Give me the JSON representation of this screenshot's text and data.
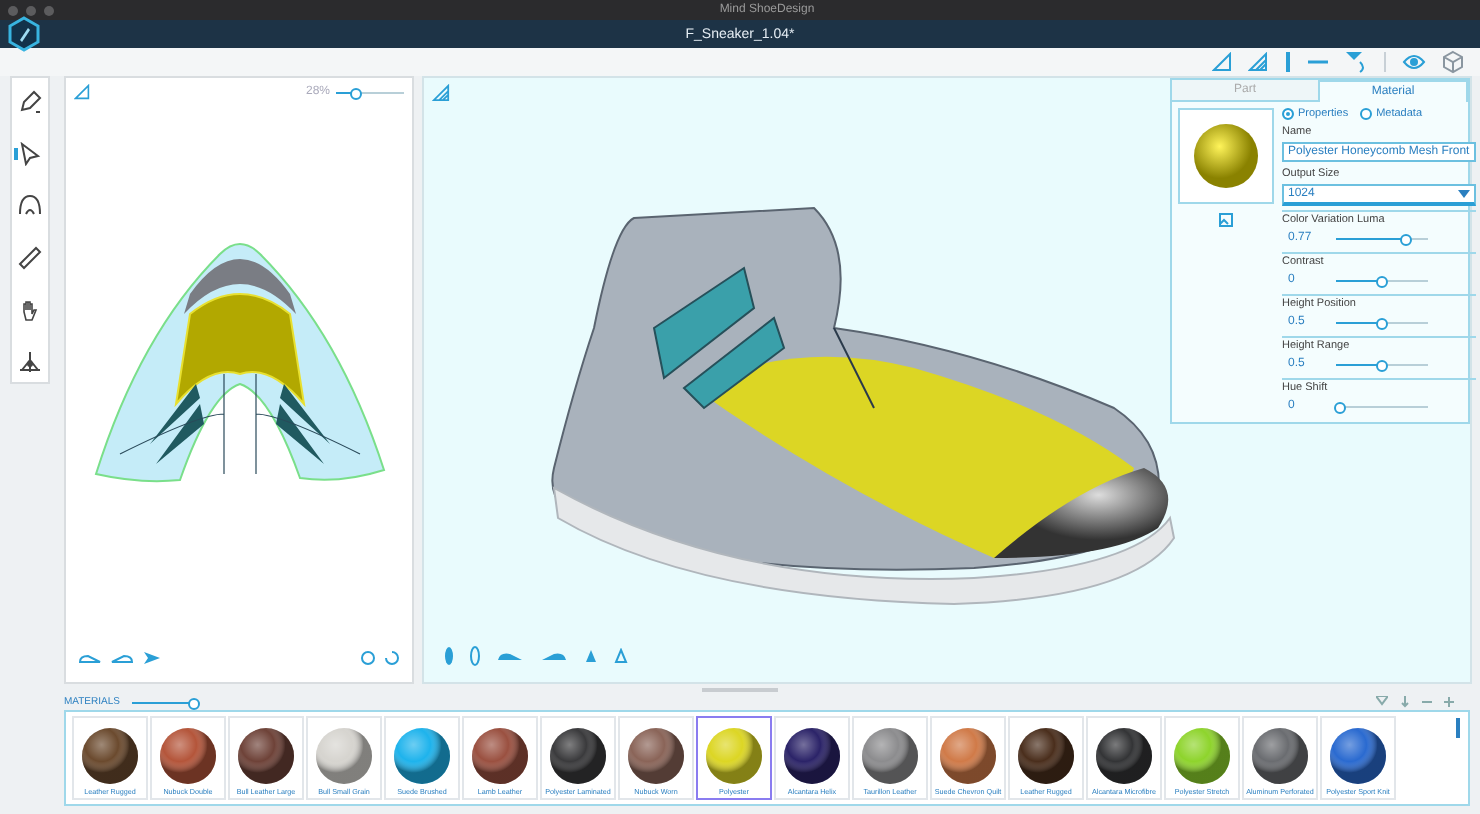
{
  "window": {
    "title": "Mind ShoeDesign",
    "document_title": "F_Sneaker_1.04*"
  },
  "pattern_panel": {
    "zoom": "28%",
    "level": 0.3
  },
  "properties": {
    "tabs": [
      {
        "label": "Part",
        "selected": false
      },
      {
        "label": "Material",
        "selected": true
      }
    ],
    "modes": [
      {
        "label": "Properties",
        "selected": true
      },
      {
        "label": "Metadata",
        "selected": false
      }
    ],
    "name_label": "Name",
    "name_value": "Polyester Honeycomb Mesh Front",
    "size_label": "Output Size",
    "size_value": "1024",
    "sliders": [
      {
        "name": "Color Variation Luma",
        "reading": "0.77",
        "level": 0.75
      },
      {
        "name": "Contrast",
        "reading": "0",
        "level": 0.5
      },
      {
        "name": "Height Position",
        "reading": "0.5",
        "level": 0.5
      },
      {
        "name": "Height Range",
        "reading": "0.5",
        "level": 0.5
      },
      {
        "name": "Hue Shift",
        "reading": "0",
        "level": 0.05
      }
    ]
  },
  "materials": {
    "title": "MATERIALS",
    "level": 0.9,
    "items": [
      {
        "name": "Leather Rugged",
        "color": "#6b4a2e",
        "selected": false
      },
      {
        "name": "Nubuck Double",
        "color": "#b4553a",
        "selected": false
      },
      {
        "name": "Bull Leather Large",
        "color": "#6e4238",
        "selected": false
      },
      {
        "name": "Bull Small Grain",
        "color": "#d6d4cf",
        "selected": false
      },
      {
        "name": "Suede Brushed",
        "color": "#1eb3ec",
        "selected": false
      },
      {
        "name": "Lamb Leather",
        "color": "#9a5040",
        "selected": false
      },
      {
        "name": "Polyester Laminated",
        "color": "#3a3a3c",
        "selected": false
      },
      {
        "name": "Nubuck Worn",
        "color": "#8a6458",
        "selected": false
      },
      {
        "name": "Polyester",
        "color": "#dcd624",
        "selected": true
      },
      {
        "name": "Alcantara Helix",
        "color": "#2b2368",
        "selected": false
      },
      {
        "name": "Taurillon Leather",
        "color": "#8c8c8e",
        "selected": false
      },
      {
        "name": "Suede Chevron Quilt",
        "color": "#d07a48",
        "selected": false
      },
      {
        "name": "Leather Rugged",
        "color": "#4a2e1c",
        "selected": false
      },
      {
        "name": "Alcantara Microfibre",
        "color": "#333436",
        "selected": false
      },
      {
        "name": "Polyester Stretch",
        "color": "#8ed42c",
        "selected": false
      },
      {
        "name": "Aluminum Perforated",
        "color": "#6a6c70",
        "selected": false
      },
      {
        "name": "Polyester Sport Knit",
        "color": "#2a6ad0",
        "selected": false
      }
    ]
  }
}
